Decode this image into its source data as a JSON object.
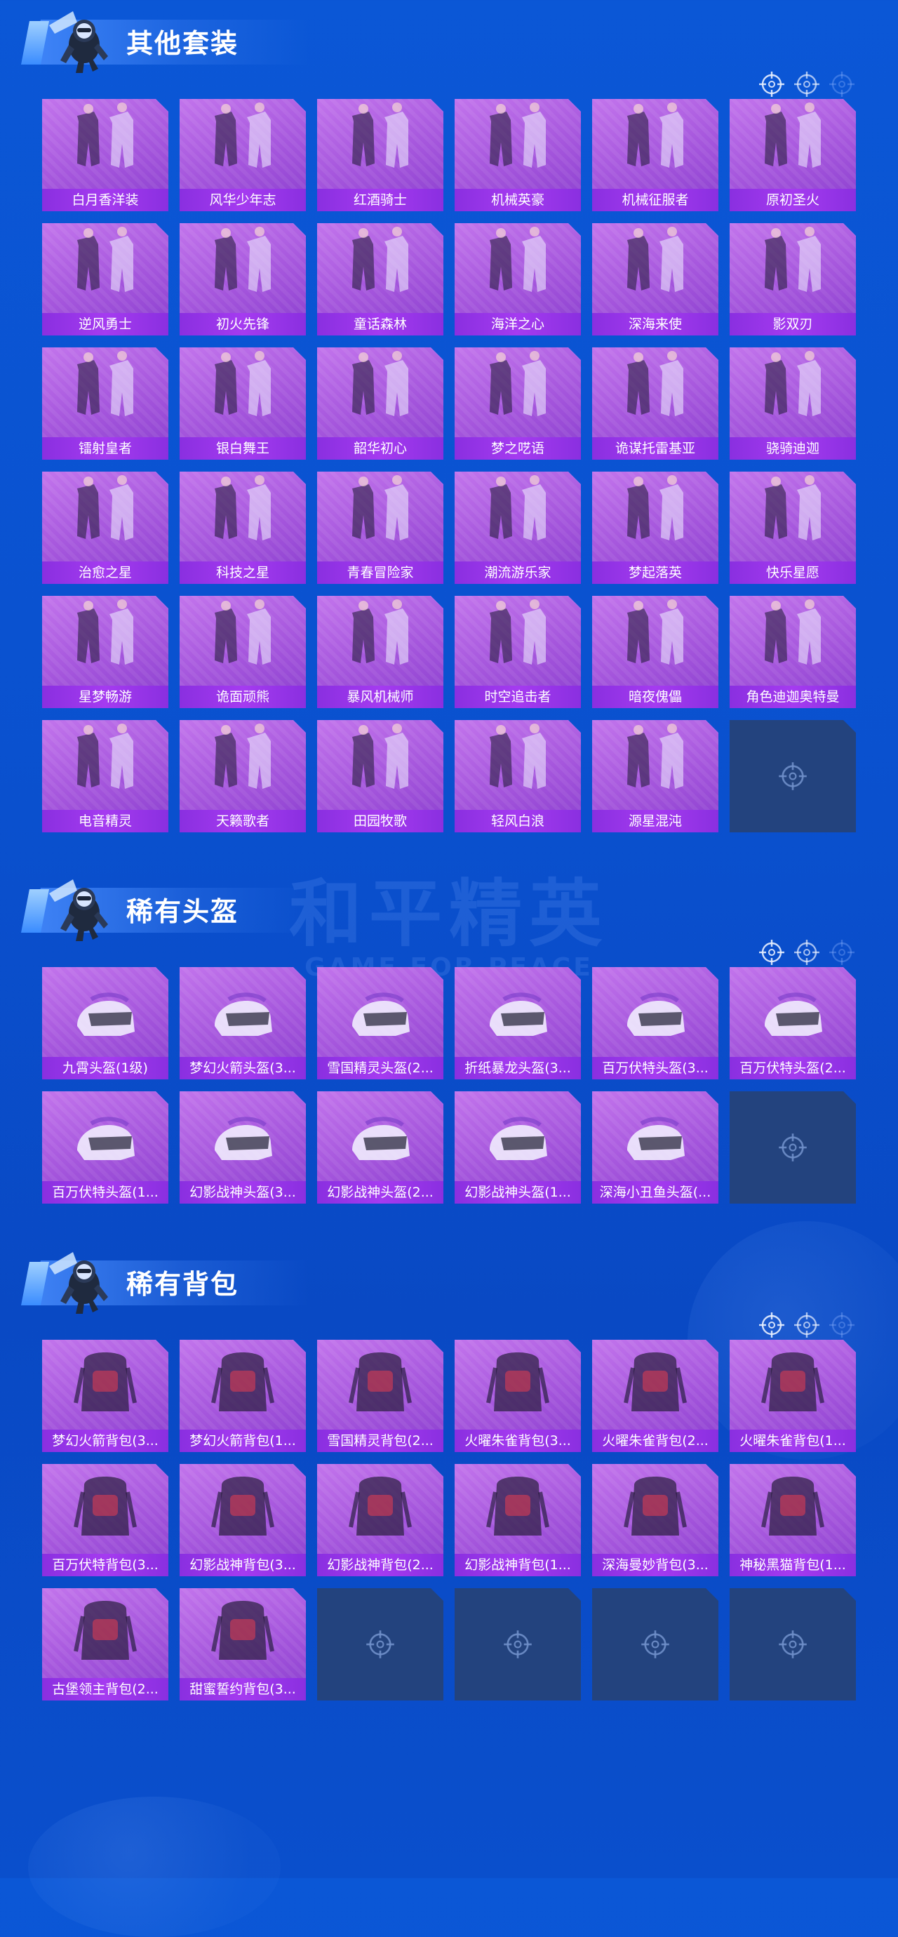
{
  "sections": [
    {
      "title": "其他套装",
      "icon": "parachute-mascot-icon",
      "items": [
        "白月香洋装",
        "风华少年志",
        "红酒骑士",
        "机械英豪",
        "机械征服者",
        "原初圣火",
        "逆风勇士",
        "初火先锋",
        "童话森林",
        "海洋之心",
        "深海来使",
        "影双刃",
        "镭射皇者",
        "银白舞王",
        "韶华初心",
        "梦之呓语",
        "诡谋托雷基亚",
        "骁骑迪迦",
        "治愈之星",
        "科技之星",
        "青春冒险家",
        "潮流游乐家",
        "梦起落英",
        "快乐星愿",
        "星梦畅游",
        "诡面顽熊",
        "暴风机械师",
        "时空追击者",
        "暗夜傀儡",
        "角色迪迦奥特曼",
        "电音精灵",
        "天籁歌者",
        "田园牧歌",
        "轻风白浪",
        "源星混沌",
        ""
      ]
    },
    {
      "title": "稀有头盔",
      "icon": "parachute-mascot-icon",
      "items": [
        "九霄头盔(1级)",
        "梦幻火箭头盔(3...",
        "雪国精灵头盔(2...",
        "折纸暴龙头盔(3...",
        "百万伏特头盔(3...",
        "百万伏特头盔(2...",
        "百万伏特头盔(1...",
        "幻影战神头盔(3...",
        "幻影战神头盔(2...",
        "幻影战神头盔(1...",
        "深海小丑鱼头盔(...",
        ""
      ]
    },
    {
      "title": "稀有背包",
      "icon": "parachute-mascot-icon",
      "items": [
        "梦幻火箭背包(3...",
        "梦幻火箭背包(1...",
        "雪国精灵背包(2...",
        "火曜朱雀背包(3...",
        "火曜朱雀背包(2...",
        "火曜朱雀背包(1...",
        "百万伏特背包(3...",
        "幻影战神背包(3...",
        "幻影战神背包(2...",
        "幻影战神背包(1...",
        "深海曼妙背包(3...",
        "神秘黑猫背包(1...",
        "古堡领主背包(2...",
        "甜蜜誓约背包(3...",
        "",
        "",
        "",
        ""
      ]
    }
  ],
  "watermark": {
    "cn": "和平精英",
    "en": "GAME FOR PEACE"
  },
  "header_icon": "crosshair-icon",
  "empty_slot_icon": "crosshair-icon",
  "colors": {
    "background": "#0b57d6",
    "card": "#a455dc",
    "label_bar": "#9a36ea",
    "empty_card": "#23437e",
    "title_text": "#ffffff"
  }
}
